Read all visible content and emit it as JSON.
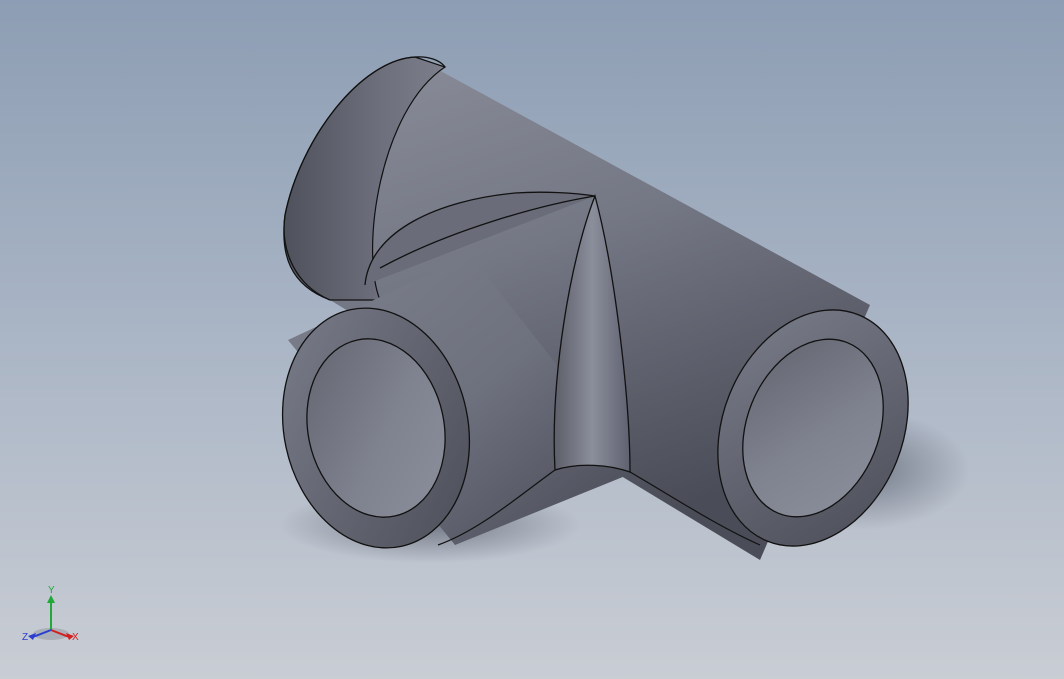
{
  "viewport": {
    "model": "pipe-tee",
    "background_top": "#8d9db3",
    "background_bottom": "#c9cdd4",
    "part_color": "#6f7280",
    "edge_color": "#111111"
  },
  "triad": {
    "x_label": "X",
    "y_label": "Y",
    "z_label": "Z",
    "x_color": "#d22020",
    "y_color": "#22a83a",
    "z_color": "#2a3fcf"
  }
}
